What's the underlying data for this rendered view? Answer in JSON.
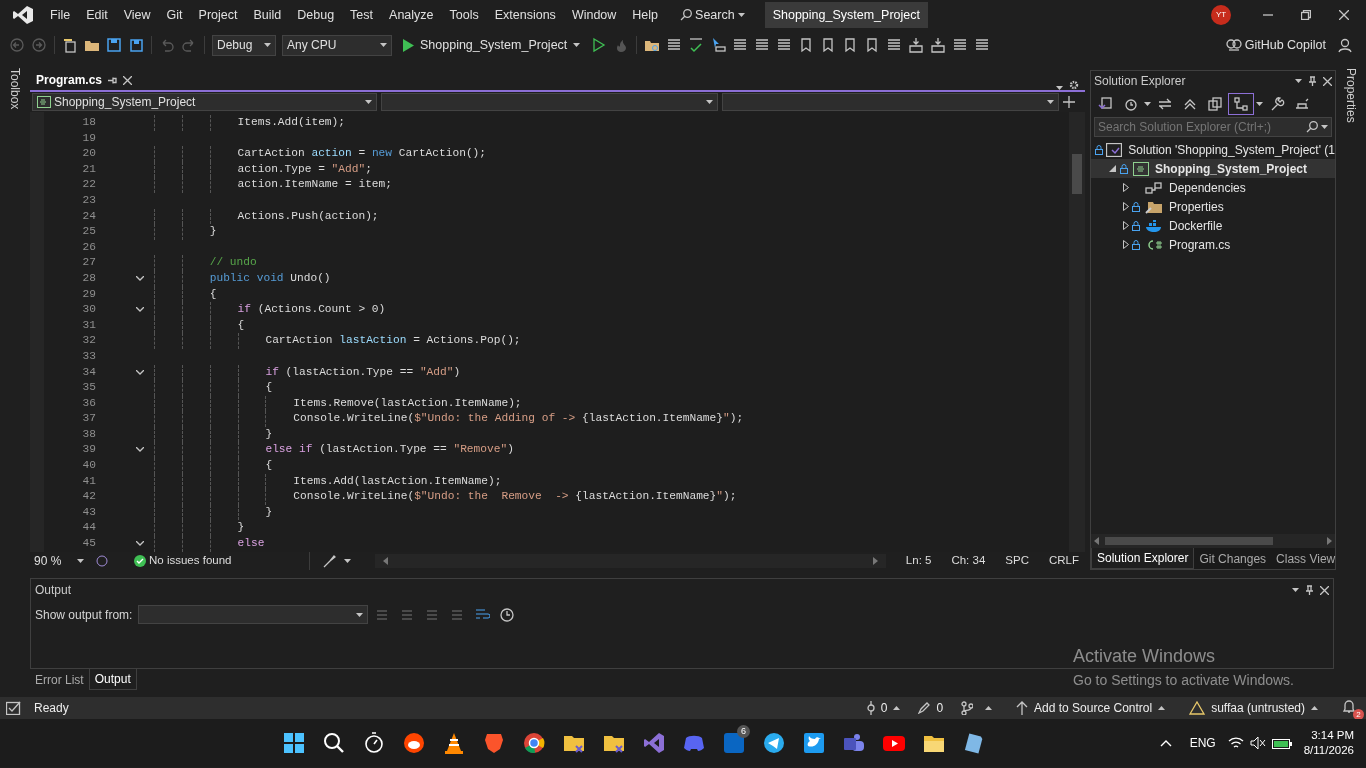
{
  "menu_bar": {
    "items": [
      "File",
      "Edit",
      "View",
      "Git",
      "Project",
      "Build",
      "Debug",
      "Test",
      "Analyze",
      "Tools",
      "Extensions",
      "Window",
      "Help"
    ],
    "search": "Search",
    "solution_title": "Shopping_System_Project",
    "avatar": "YT"
  },
  "toolbar": {
    "configuration": "Debug",
    "platform": "Any CPU",
    "start_target": "Shopping_System_Project",
    "copilot": "GitHub Copilot"
  },
  "left_strip": {
    "label": "Toolbox"
  },
  "editor": {
    "tabs": [
      {
        "label": "Program.cs",
        "selected": true
      }
    ],
    "nav": {
      "project": "Shopping_System_Project"
    },
    "lines": [
      {
        "num": "18",
        "fold": false,
        "tokens": [
          {
            "kind": "plain",
            "text": "            Items.Add(item);"
          }
        ]
      },
      {
        "num": "19",
        "fold": false
      },
      {
        "num": "20",
        "fold": false,
        "tokens": [
          {
            "kind": "plain",
            "text": "            CartAction "
          },
          {
            "kind": "local",
            "text": "action"
          },
          {
            "kind": "plain",
            "text": " = "
          },
          {
            "kind": "keyword",
            "text": "new"
          },
          {
            "kind": "plain",
            "text": " CartAction();"
          }
        ]
      },
      {
        "num": "21",
        "fold": false,
        "tokens": [
          {
            "kind": "plain",
            "text": "            action.Type = "
          },
          {
            "kind": "string",
            "text": "\"Add\""
          },
          {
            "kind": "plain",
            "text": ";"
          }
        ]
      },
      {
        "num": "22",
        "fold": false,
        "tokens": [
          {
            "kind": "plain",
            "text": "            action.ItemName = item;"
          }
        ]
      },
      {
        "num": "23",
        "fold": false
      },
      {
        "num": "24",
        "fold": false,
        "tokens": [
          {
            "kind": "plain",
            "text": "            Actions.Push(action);"
          }
        ]
      },
      {
        "num": "25",
        "fold": false,
        "tokens": [
          {
            "kind": "plain",
            "text": "        }"
          }
        ]
      },
      {
        "num": "26",
        "fold": false
      },
      {
        "num": "27",
        "fold": false,
        "tokens": [
          {
            "kind": "comment",
            "text": "        // undo"
          }
        ]
      },
      {
        "num": "28",
        "fold": true,
        "tokens": [
          {
            "kind": "keyword",
            "text": "        public void"
          },
          {
            "kind": "plain",
            "text": " Undo()"
          }
        ]
      },
      {
        "num": "29",
        "fold": false,
        "tokens": [
          {
            "kind": "plain",
            "text": "        {"
          }
        ]
      },
      {
        "num": "30",
        "fold": true,
        "tokens": [
          {
            "kind": "control",
            "text": "            if"
          },
          {
            "kind": "plain",
            "text": " (Actions.Count > 0)"
          }
        ]
      },
      {
        "num": "31",
        "fold": false,
        "tokens": [
          {
            "kind": "plain",
            "text": "            {"
          }
        ]
      },
      {
        "num": "32",
        "fold": false,
        "tokens": [
          {
            "kind": "plain",
            "text": "                CartAction "
          },
          {
            "kind": "local",
            "text": "lastAction"
          },
          {
            "kind": "plain",
            "text": " = Actions.Pop();"
          }
        ]
      },
      {
        "num": "33",
        "fold": false
      },
      {
        "num": "34",
        "fold": true,
        "tokens": [
          {
            "kind": "control",
            "text": "                if"
          },
          {
            "kind": "plain",
            "text": " (lastAction.Type == "
          },
          {
            "kind": "string",
            "text": "\"Add\""
          },
          {
            "kind": "plain",
            "text": ")"
          }
        ]
      },
      {
        "num": "35",
        "fold": false,
        "tokens": [
          {
            "kind": "plain",
            "text": "                {"
          }
        ]
      },
      {
        "num": "36",
        "fold": false,
        "tokens": [
          {
            "kind": "plain",
            "text": "                    Items.Remove(lastAction.ItemName);"
          }
        ]
      },
      {
        "num": "37",
        "fold": false,
        "tokens": [
          {
            "kind": "plain",
            "text": "                    Console.WriteLine("
          },
          {
            "kind": "string",
            "text": "$\"Undo: the Adding of -> "
          },
          {
            "kind": "plain",
            "text": "{lastAction.ItemName}"
          },
          {
            "kind": "string",
            "text": "\""
          },
          {
            "kind": "plain",
            "text": ");"
          }
        ]
      },
      {
        "num": "38",
        "fold": false,
        "tokens": [
          {
            "kind": "plain",
            "text": "                }"
          }
        ]
      },
      {
        "num": "39",
        "fold": true,
        "tokens": [
          {
            "kind": "control",
            "text": "                else if"
          },
          {
            "kind": "plain",
            "text": " (lastAction.Type == "
          },
          {
            "kind": "string",
            "text": "\"Remove\""
          },
          {
            "kind": "plain",
            "text": ")"
          }
        ]
      },
      {
        "num": "40",
        "fold": false,
        "tokens": [
          {
            "kind": "plain",
            "text": "                {"
          }
        ]
      },
      {
        "num": "41",
        "fold": false,
        "tokens": [
          {
            "kind": "plain",
            "text": "                    Items.Add(lastAction.ItemName);"
          }
        ]
      },
      {
        "num": "42",
        "fold": false,
        "tokens": [
          {
            "kind": "plain",
            "text": "                    Console.WriteLine("
          },
          {
            "kind": "string",
            "text": "$\"Undo: the  Remove  -> "
          },
          {
            "kind": "plain",
            "text": "{lastAction.ItemName}"
          },
          {
            "kind": "string",
            "text": "\""
          },
          {
            "kind": "plain",
            "text": ");"
          }
        ]
      },
      {
        "num": "43",
        "fold": false,
        "tokens": [
          {
            "kind": "plain",
            "text": "                }"
          }
        ]
      },
      {
        "num": "44",
        "fold": false,
        "tokens": [
          {
            "kind": "plain",
            "text": "            }"
          }
        ]
      },
      {
        "num": "45",
        "fold": true,
        "tokens": [
          {
            "kind": "control",
            "text": "            else"
          }
        ]
      }
    ],
    "status": {
      "zoom": "90 %",
      "issues": "No issues found",
      "line": "Ln: 5",
      "col": "Ch: 34",
      "whitespace": "SPC",
      "line_ending": "CRLF"
    }
  },
  "solution_explorer": {
    "title": "Solution Explorer",
    "search": {
      "placeholder": "Search Solution Explorer (Ctrl+;)"
    },
    "tree": [
      {
        "label": "Solution 'Shopping_System_Project' (1",
        "kind": "solution",
        "locked": true,
        "selected": false,
        "children": [
          {
            "label": "Shopping_System_Project",
            "kind": "project",
            "locked": true,
            "expanded": true,
            "selected": true,
            "children": [
              {
                "label": "Dependencies",
                "kind": "dependencies",
                "locked": false,
                "expanded": false,
                "selected": false
              },
              {
                "label": "Properties",
                "kind": "properties",
                "locked": true,
                "expanded": false,
                "selected": false
              },
              {
                "label": "Dockerfile",
                "kind": "docker",
                "locked": true,
                "expanded": false,
                "selected": false
              },
              {
                "label": "Program.cs",
                "kind": "csharp",
                "locked": true,
                "expanded": false,
                "selected": false
              }
            ]
          }
        ]
      }
    ],
    "tabs": [
      {
        "label": "Solution Explorer",
        "selected": true
      },
      {
        "label": "Git Changes",
        "selected": false
      },
      {
        "label": "Class View",
        "selected": false
      }
    ]
  },
  "right_strip": {
    "label": "Properties"
  },
  "output": {
    "title": "Output",
    "show_from_label": "Show output from:",
    "tabs": [
      {
        "label": "Error List",
        "selected": false
      },
      {
        "label": "Output",
        "selected": true
      }
    ]
  },
  "activation": {
    "title": "Activate Windows",
    "subtitle": "Go to Settings to activate Windows."
  },
  "status_bar": {
    "state": "Ready",
    "up_count": "0",
    "edit_count": "0",
    "source_control": "Add to Source Control",
    "repo": "suffaa (untrusted)",
    "notifications": "2"
  },
  "taskbar": {
    "apps": [
      {
        "kind": "start"
      },
      {
        "kind": "search"
      },
      {
        "kind": "stopwatch"
      },
      {
        "kind": "reddit"
      },
      {
        "kind": "cone"
      },
      {
        "kind": "shield"
      },
      {
        "kind": "browser"
      },
      {
        "kind": "gitfolder"
      },
      {
        "kind": "gitfolder"
      },
      {
        "kind": "vs"
      },
      {
        "kind": "discord"
      },
      {
        "kind": "linkedin",
        "badge": "6"
      },
      {
        "kind": "telegram"
      },
      {
        "kind": "bird"
      },
      {
        "kind": "teams"
      },
      {
        "kind": "play"
      },
      {
        "kind": "files"
      },
      {
        "kind": "notepad"
      }
    ],
    "language": "ENG",
    "time": "3:14 PM",
    "date": "8/11/2026"
  }
}
